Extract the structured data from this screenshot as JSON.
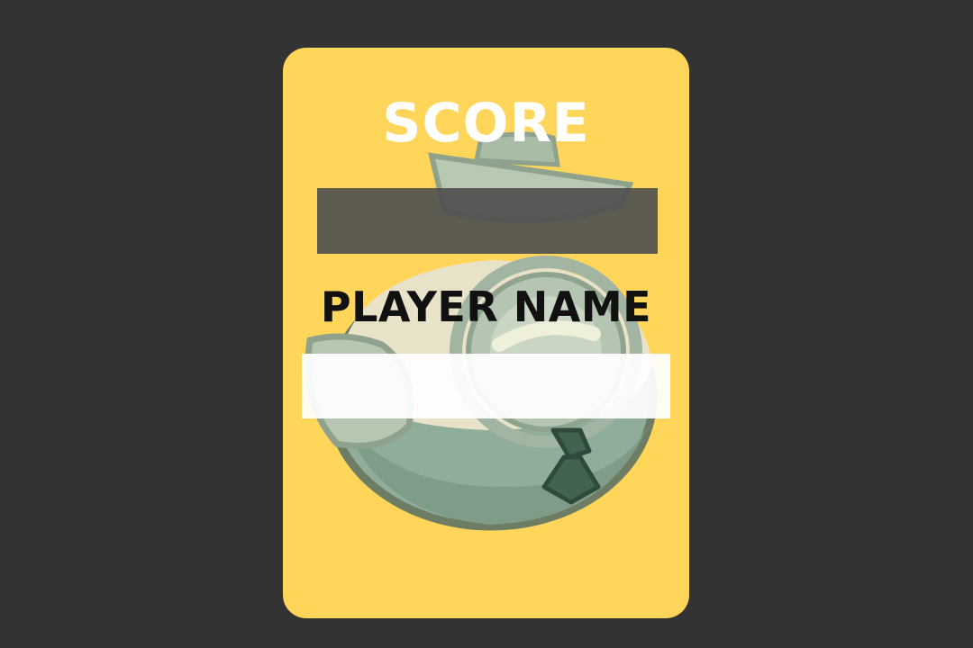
{
  "background_color": "#333333",
  "card": {
    "color": "#ffd65a",
    "mascot_icon": "cyclops-sailor-mascot-icon",
    "score_label": "SCORE",
    "score_value": "",
    "player_name_label": "PLAYER NAME",
    "player_name_value": ""
  }
}
